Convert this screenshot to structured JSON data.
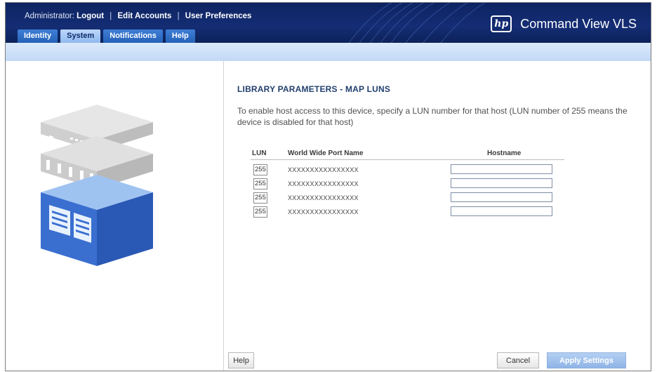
{
  "header": {
    "admin_label": "Administrator:",
    "links": [
      "Logout",
      "Edit Accounts",
      "User Preferences"
    ],
    "separator": "|",
    "tabs": [
      {
        "label": "Identity",
        "active": false
      },
      {
        "label": "System",
        "active": true
      },
      {
        "label": "Notifications",
        "active": false
      },
      {
        "label": "Help",
        "active": false
      }
    ],
    "logo_text": "hp",
    "product_name": "Command View VLS"
  },
  "main": {
    "title": "LIBRARY PARAMETERS - MAP LUNS",
    "description": "To enable host access to this device, specify a LUN number for that host (LUN number of 255 means the device is disabled for that host)",
    "columns": {
      "lun": "LUN",
      "wwpn": "World Wide Port Name",
      "hostname": "Hostname"
    },
    "rows": [
      {
        "lun": "255",
        "wwpn": "XXXXXXXXXXXXXXXX",
        "hostname": ""
      },
      {
        "lun": "255",
        "wwpn": "XXXXXXXXXXXXXXXX",
        "hostname": ""
      },
      {
        "lun": "255",
        "wwpn": "XXXXXXXXXXXXXXXX",
        "hostname": ""
      },
      {
        "lun": "255",
        "wwpn": "XXXXXXXXXXXXXXXX",
        "hostname": ""
      }
    ]
  },
  "footer": {
    "help_label": "Help",
    "cancel_label": "Cancel",
    "apply_label": "Apply Settings"
  },
  "colors": {
    "header_bg": "#142d74",
    "tab": "#2461b8",
    "tab_active": "#bcd7fb",
    "accent_bar": "#c2d8f6",
    "title": "#23406f",
    "apply_button": "#8fb4e6"
  }
}
